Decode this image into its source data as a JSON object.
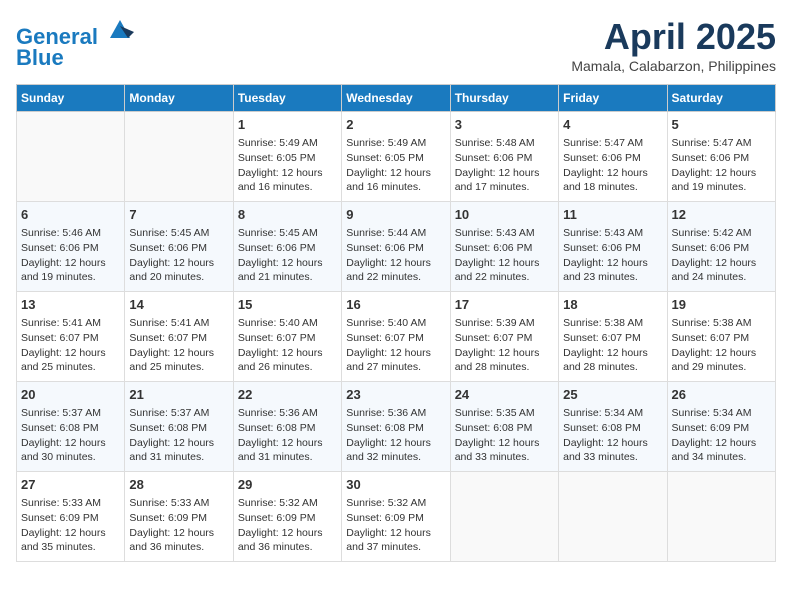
{
  "header": {
    "logo_line1": "General",
    "logo_line2": "Blue",
    "month": "April 2025",
    "location": "Mamala, Calabarzon, Philippines"
  },
  "weekdays": [
    "Sunday",
    "Monday",
    "Tuesday",
    "Wednesday",
    "Thursday",
    "Friday",
    "Saturday"
  ],
  "weeks": [
    [
      {
        "day": "",
        "info": ""
      },
      {
        "day": "",
        "info": ""
      },
      {
        "day": "1",
        "info": "Sunrise: 5:49 AM\nSunset: 6:05 PM\nDaylight: 12 hours and 16 minutes."
      },
      {
        "day": "2",
        "info": "Sunrise: 5:49 AM\nSunset: 6:05 PM\nDaylight: 12 hours and 16 minutes."
      },
      {
        "day": "3",
        "info": "Sunrise: 5:48 AM\nSunset: 6:06 PM\nDaylight: 12 hours and 17 minutes."
      },
      {
        "day": "4",
        "info": "Sunrise: 5:47 AM\nSunset: 6:06 PM\nDaylight: 12 hours and 18 minutes."
      },
      {
        "day": "5",
        "info": "Sunrise: 5:47 AM\nSunset: 6:06 PM\nDaylight: 12 hours and 19 minutes."
      }
    ],
    [
      {
        "day": "6",
        "info": "Sunrise: 5:46 AM\nSunset: 6:06 PM\nDaylight: 12 hours and 19 minutes."
      },
      {
        "day": "7",
        "info": "Sunrise: 5:45 AM\nSunset: 6:06 PM\nDaylight: 12 hours and 20 minutes."
      },
      {
        "day": "8",
        "info": "Sunrise: 5:45 AM\nSunset: 6:06 PM\nDaylight: 12 hours and 21 minutes."
      },
      {
        "day": "9",
        "info": "Sunrise: 5:44 AM\nSunset: 6:06 PM\nDaylight: 12 hours and 22 minutes."
      },
      {
        "day": "10",
        "info": "Sunrise: 5:43 AM\nSunset: 6:06 PM\nDaylight: 12 hours and 22 minutes."
      },
      {
        "day": "11",
        "info": "Sunrise: 5:43 AM\nSunset: 6:06 PM\nDaylight: 12 hours and 23 minutes."
      },
      {
        "day": "12",
        "info": "Sunrise: 5:42 AM\nSunset: 6:06 PM\nDaylight: 12 hours and 24 minutes."
      }
    ],
    [
      {
        "day": "13",
        "info": "Sunrise: 5:41 AM\nSunset: 6:07 PM\nDaylight: 12 hours and 25 minutes."
      },
      {
        "day": "14",
        "info": "Sunrise: 5:41 AM\nSunset: 6:07 PM\nDaylight: 12 hours and 25 minutes."
      },
      {
        "day": "15",
        "info": "Sunrise: 5:40 AM\nSunset: 6:07 PM\nDaylight: 12 hours and 26 minutes."
      },
      {
        "day": "16",
        "info": "Sunrise: 5:40 AM\nSunset: 6:07 PM\nDaylight: 12 hours and 27 minutes."
      },
      {
        "day": "17",
        "info": "Sunrise: 5:39 AM\nSunset: 6:07 PM\nDaylight: 12 hours and 28 minutes."
      },
      {
        "day": "18",
        "info": "Sunrise: 5:38 AM\nSunset: 6:07 PM\nDaylight: 12 hours and 28 minutes."
      },
      {
        "day": "19",
        "info": "Sunrise: 5:38 AM\nSunset: 6:07 PM\nDaylight: 12 hours and 29 minutes."
      }
    ],
    [
      {
        "day": "20",
        "info": "Sunrise: 5:37 AM\nSunset: 6:08 PM\nDaylight: 12 hours and 30 minutes."
      },
      {
        "day": "21",
        "info": "Sunrise: 5:37 AM\nSunset: 6:08 PM\nDaylight: 12 hours and 31 minutes."
      },
      {
        "day": "22",
        "info": "Sunrise: 5:36 AM\nSunset: 6:08 PM\nDaylight: 12 hours and 31 minutes."
      },
      {
        "day": "23",
        "info": "Sunrise: 5:36 AM\nSunset: 6:08 PM\nDaylight: 12 hours and 32 minutes."
      },
      {
        "day": "24",
        "info": "Sunrise: 5:35 AM\nSunset: 6:08 PM\nDaylight: 12 hours and 33 minutes."
      },
      {
        "day": "25",
        "info": "Sunrise: 5:34 AM\nSunset: 6:08 PM\nDaylight: 12 hours and 33 minutes."
      },
      {
        "day": "26",
        "info": "Sunrise: 5:34 AM\nSunset: 6:09 PM\nDaylight: 12 hours and 34 minutes."
      }
    ],
    [
      {
        "day": "27",
        "info": "Sunrise: 5:33 AM\nSunset: 6:09 PM\nDaylight: 12 hours and 35 minutes."
      },
      {
        "day": "28",
        "info": "Sunrise: 5:33 AM\nSunset: 6:09 PM\nDaylight: 12 hours and 36 minutes."
      },
      {
        "day": "29",
        "info": "Sunrise: 5:32 AM\nSunset: 6:09 PM\nDaylight: 12 hours and 36 minutes."
      },
      {
        "day": "30",
        "info": "Sunrise: 5:32 AM\nSunset: 6:09 PM\nDaylight: 12 hours and 37 minutes."
      },
      {
        "day": "",
        "info": ""
      },
      {
        "day": "",
        "info": ""
      },
      {
        "day": "",
        "info": ""
      }
    ]
  ]
}
